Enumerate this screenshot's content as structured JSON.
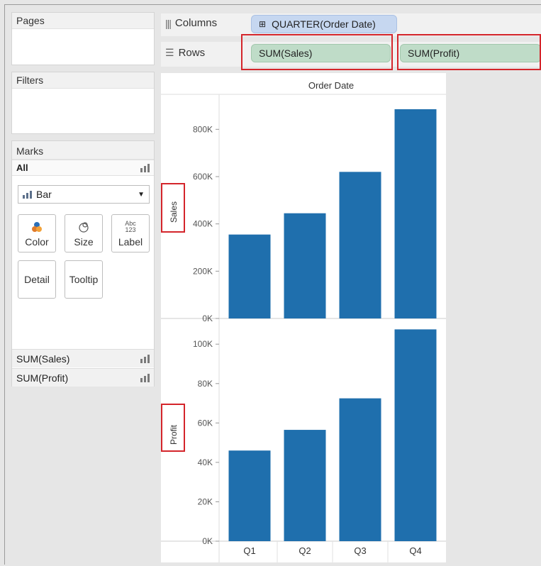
{
  "pages": {
    "title": "Pages"
  },
  "filters": {
    "title": "Filters"
  },
  "marks": {
    "title": "Marks",
    "all_label": "All",
    "mark_type": "Bar",
    "buttons": {
      "color": "Color",
      "size": "Size",
      "label": "Label",
      "label_glyph_top": "Abc",
      "label_glyph_bottom": "123",
      "detail": "Detail",
      "tooltip": "Tooltip"
    },
    "measures": [
      "SUM(Sales)",
      "SUM(Profit)"
    ]
  },
  "shelves": {
    "columns_label": "Columns",
    "rows_label": "Rows",
    "columns_pill": "QUARTER(Order Date)",
    "columns_pill_icon": "⊞",
    "rows_pills": [
      "SUM(Sales)",
      "SUM(Profit)"
    ]
  },
  "colors": {
    "bar": "#1f6fad",
    "highlight": "#d4252b"
  },
  "chart_data": {
    "type": "bar",
    "title": "Order Date",
    "categories": [
      "Q1",
      "Q2",
      "Q3",
      "Q4"
    ],
    "panels": [
      {
        "ylabel": "Sales",
        "ylim": [
          0,
          900000
        ],
        "ticks": [
          0,
          200000,
          400000,
          600000,
          800000
        ],
        "tick_labels": [
          "0K",
          "200K",
          "400K",
          "600K",
          "800K"
        ],
        "values": [
          355000,
          445000,
          620000,
          885000
        ]
      },
      {
        "ylabel": "Profit",
        "ylim": [
          0,
          108000
        ],
        "ticks": [
          0,
          20000,
          40000,
          60000,
          80000,
          100000
        ],
        "tick_labels": [
          "0K",
          "20K",
          "40K",
          "60K",
          "80K",
          "100K"
        ],
        "values": [
          46000,
          56500,
          72500,
          107500
        ]
      }
    ]
  }
}
